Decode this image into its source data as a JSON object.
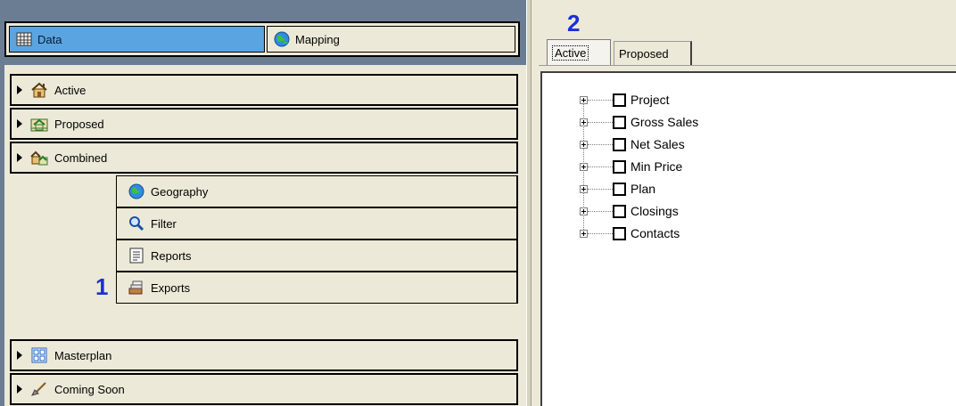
{
  "left_panel": {
    "top_tabs": [
      {
        "label": "Data",
        "icon": "grid-table-icon",
        "selected": true
      },
      {
        "label": "Mapping",
        "icon": "globe-icon",
        "selected": false
      }
    ],
    "nav_items": [
      {
        "label": "Active",
        "icon": "house-icon"
      },
      {
        "label": "Proposed",
        "icon": "blueprint-house-icon"
      },
      {
        "label": "Combined",
        "icon": "combined-houses-icon"
      }
    ],
    "sub_items": [
      {
        "label": "Geography",
        "icon": "globe-icon"
      },
      {
        "label": "Filter",
        "icon": "magnifier-icon"
      },
      {
        "label": "Reports",
        "icon": "report-document-icon"
      },
      {
        "label": "Exports",
        "icon": "export-stack-icon"
      }
    ],
    "bottom_items": [
      {
        "label": "Masterplan",
        "icon": "masterplan-grid-icon"
      },
      {
        "label": "Coming Soon",
        "icon": "shovel-icon"
      }
    ],
    "callout": "1"
  },
  "right_panel": {
    "callout": "2",
    "tabs": [
      {
        "label": "Active",
        "selected": true
      },
      {
        "label": "Proposed",
        "selected": false
      }
    ],
    "tree_items": [
      "Project",
      "Gross Sales",
      "Net Sales",
      "Min Price",
      "Plan",
      "Closings",
      "Contacts"
    ]
  },
  "colors": {
    "selected_tab": "#5aa5e1",
    "callout_blue": "#1a2fd8",
    "panel_bg": "#ece9d8",
    "frame_gray": "#6b7d93"
  }
}
